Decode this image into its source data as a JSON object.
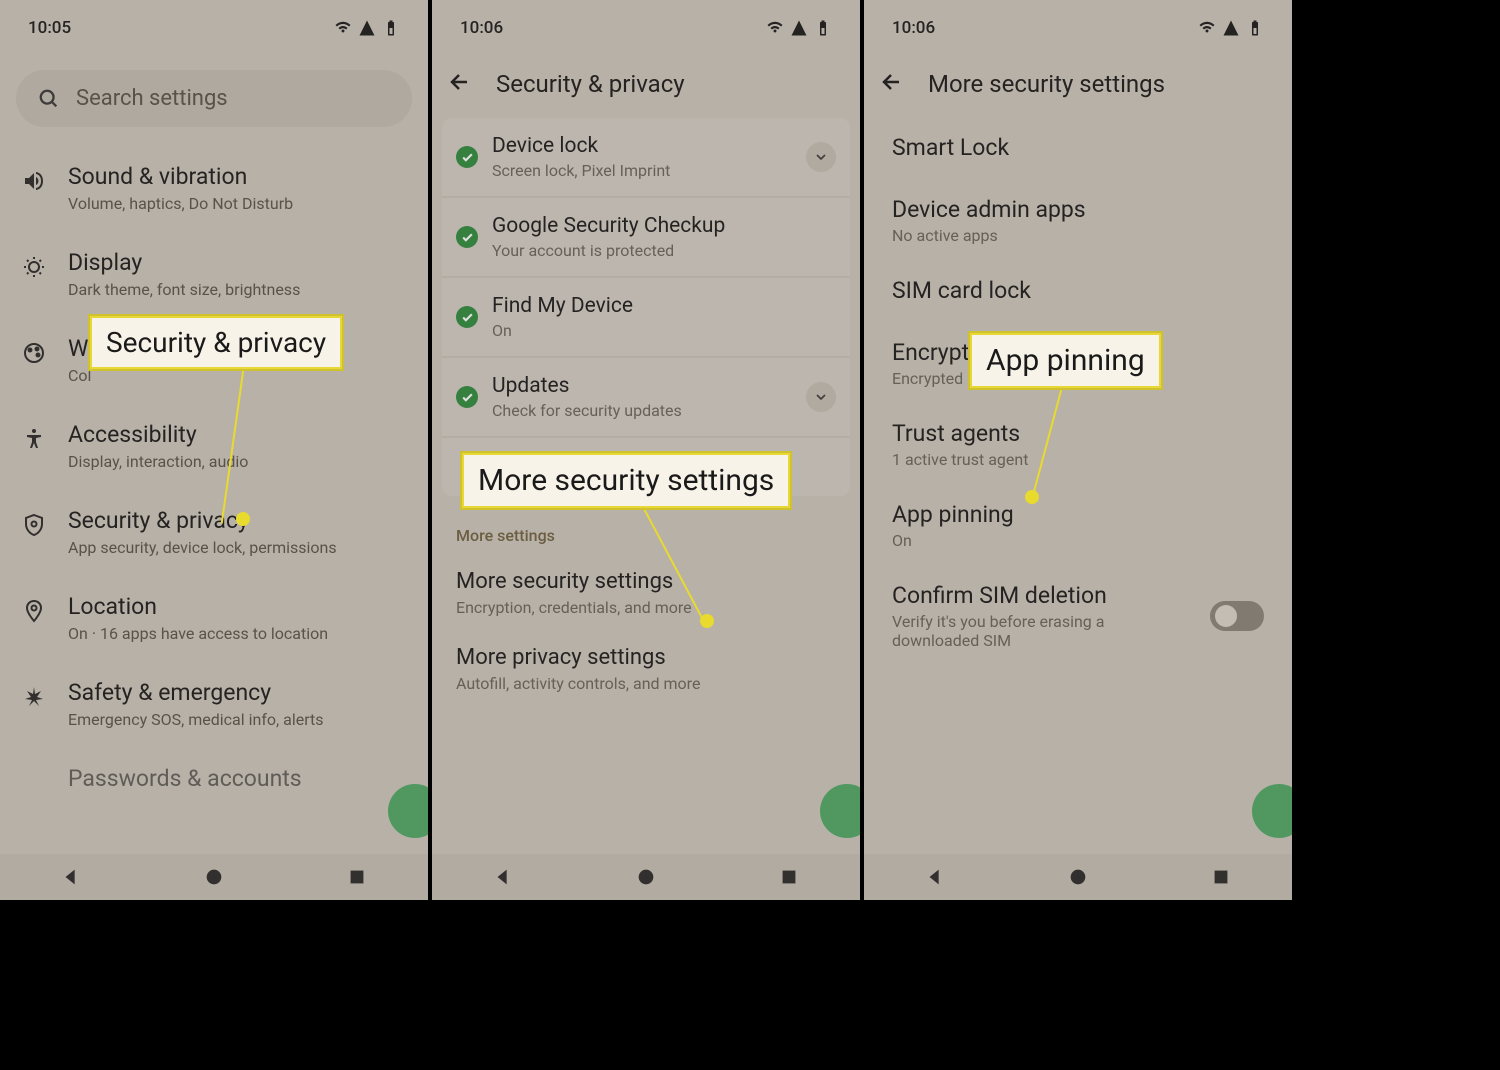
{
  "screen1": {
    "time": "10:05",
    "search_placeholder": "Search settings",
    "rows": [
      {
        "title": "Sound & vibration",
        "sub": "Volume, haptics, Do Not Disturb"
      },
      {
        "title": "Display",
        "sub": "Dark theme, font size, brightness"
      },
      {
        "title": "Wa",
        "sub": "Col"
      },
      {
        "title": "Accessibility",
        "sub": "Display, interaction, audio"
      },
      {
        "title": "Security & privacy",
        "sub": "App security, device lock, permissions"
      },
      {
        "title": "Location",
        "sub": "On · 16 apps have access to location"
      },
      {
        "title": "Safety & emergency",
        "sub": "Emergency SOS, medical info, alerts"
      },
      {
        "title": "Passwords & accounts",
        "sub": ""
      }
    ],
    "callout": "Security & privacy"
  },
  "screen2": {
    "time": "10:06",
    "page_title": "Security & privacy",
    "items": [
      {
        "title": "Device lock",
        "sub": "Screen lock, Pixel Imprint",
        "chevron": true
      },
      {
        "title": "Google Security Checkup",
        "sub": "Your account is protected",
        "chevron": false
      },
      {
        "title": "Find My Device",
        "sub": "On",
        "chevron": false
      },
      {
        "title": "Updates",
        "sub": "Check for security updates",
        "chevron": true
      }
    ],
    "card_more": "More security settings",
    "section_label": "More settings",
    "more": [
      {
        "title": "More security settings",
        "sub": "Encryption, credentials, and more"
      },
      {
        "title": "More privacy settings",
        "sub": "Autofill, activity controls, and more"
      }
    ],
    "callout": "More security settings"
  },
  "screen3": {
    "time": "10:06",
    "page_title": "More security settings",
    "items": [
      {
        "title": "Smart Lock",
        "sub": ""
      },
      {
        "title": "Device admin apps",
        "sub": "No active apps"
      },
      {
        "title": "SIM card lock",
        "sub": ""
      },
      {
        "title": "Encryption & credentials",
        "sub": "Encrypted"
      },
      {
        "title": "Trust agents",
        "sub": "1 active trust agent"
      },
      {
        "title": "App pinning",
        "sub": "On"
      },
      {
        "title": "Confirm SIM deletion",
        "sub": "Verify it's you before erasing a downloaded SIM"
      }
    ],
    "callout": "App pinning"
  }
}
